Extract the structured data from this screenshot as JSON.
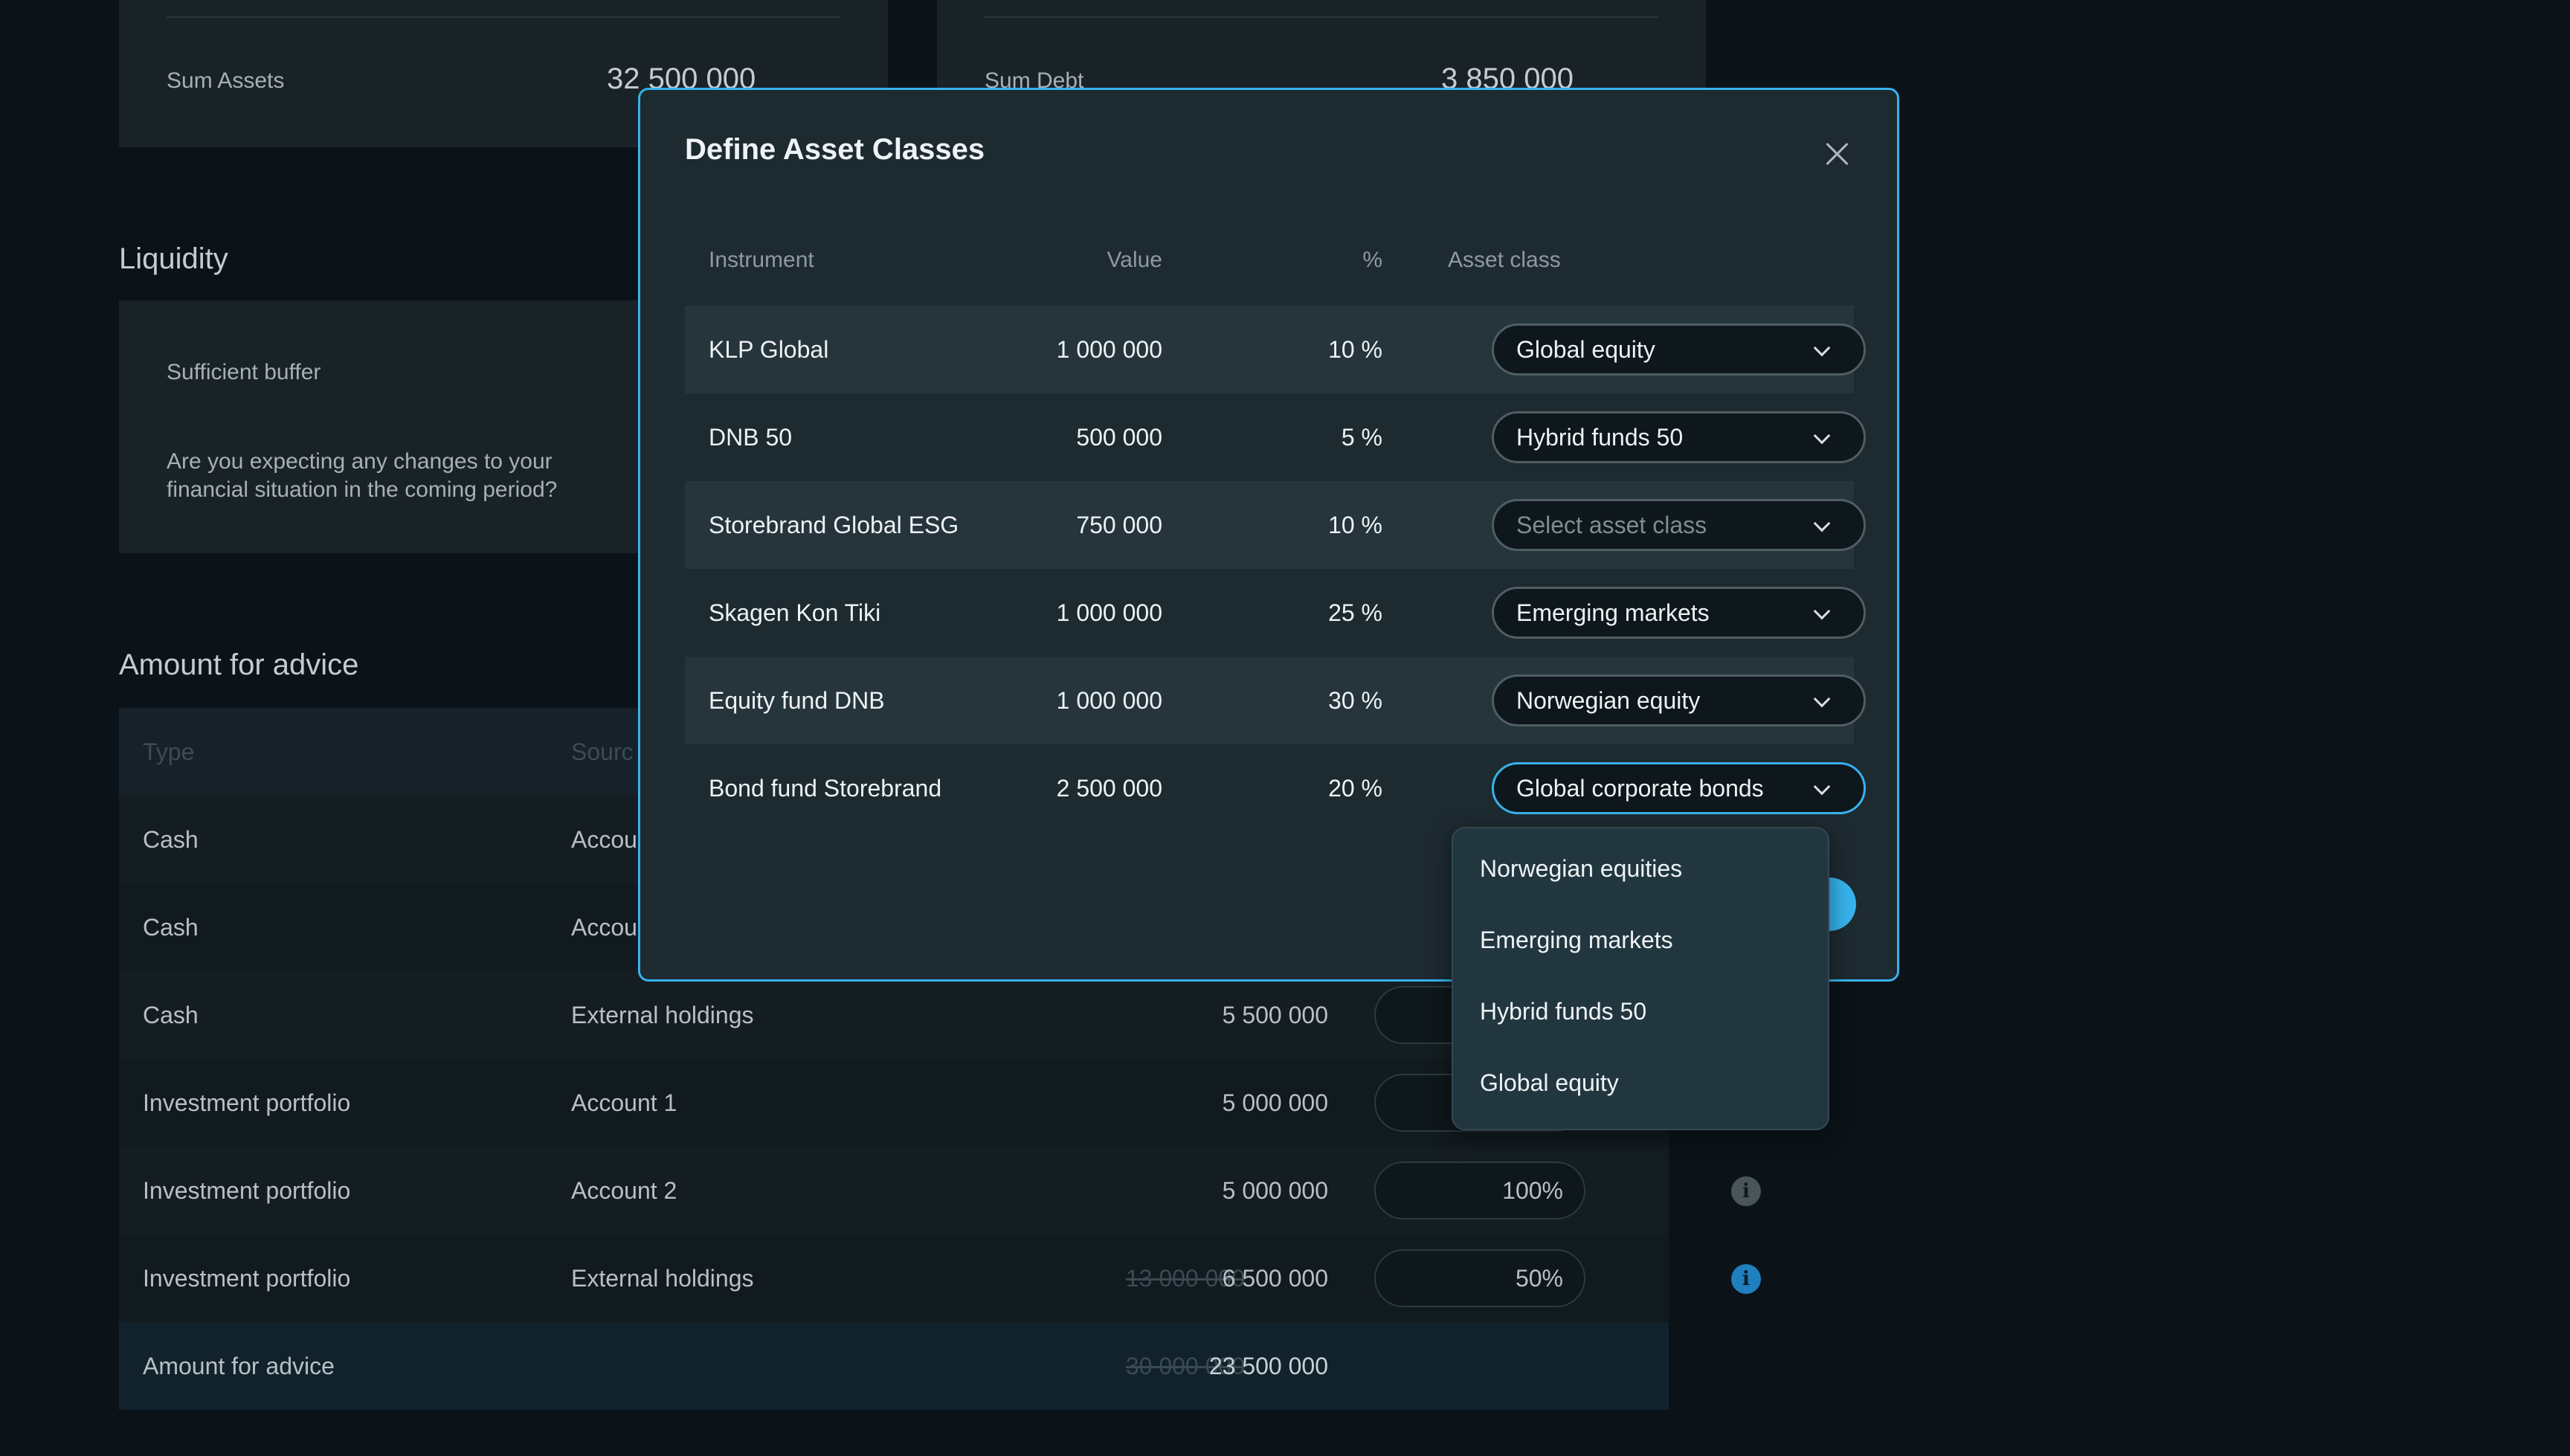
{
  "background": {
    "assets_card": {
      "label": "Sum Assets",
      "value": "32 500 000"
    },
    "debt_card": {
      "label": "Sum Debt",
      "value": "3 850 000"
    },
    "liquidity": {
      "title": "Liquidity",
      "buffer_label": "Sufficient buffer",
      "question_line1": "Are you expecting any changes to your",
      "question_line2": "financial situation in the coming period?"
    },
    "advice": {
      "title": "Amount for advice",
      "headers": {
        "type": "Type",
        "source": "Sourc"
      },
      "rows": [
        {
          "type": "Cash",
          "source": "Accou",
          "original": "",
          "value": "",
          "pct": ""
        },
        {
          "type": "Cash",
          "source": "Accou",
          "original": "",
          "value": "",
          "pct": ""
        },
        {
          "type": "Cash",
          "source": "External holdings",
          "original": "",
          "value": "5 500 000",
          "pct": ""
        },
        {
          "type": "Investment portfolio",
          "source": "Account 1",
          "original": "",
          "value": "5 000 000",
          "pct": ""
        },
        {
          "type": "Investment portfolio",
          "source": "Account 2",
          "original": "",
          "value": "5 000 000",
          "pct": "100%"
        },
        {
          "type": "Investment portfolio",
          "source": "External holdings",
          "original": "13 000 000",
          "value": "6 500 000",
          "pct": "50%"
        }
      ],
      "total": {
        "label": "Amount for advice",
        "original": "30 000 000",
        "value": "23 500 000"
      }
    }
  },
  "modal": {
    "title": "Define Asset Classes",
    "columns": {
      "instrument": "Instrument",
      "value": "Value",
      "percent": "%",
      "asset_class": "Asset class"
    },
    "rows": [
      {
        "instrument": "KLP Global",
        "value": "1 000 000",
        "percent": "10 %",
        "asset_class": "Global equity",
        "placeholder": false
      },
      {
        "instrument": "DNB 50",
        "value": "500 000",
        "percent": "5 %",
        "asset_class": "Hybrid funds 50",
        "placeholder": false
      },
      {
        "instrument": "Storebrand Global ESG",
        "value": "750 000",
        "percent": "10 %",
        "asset_class": "Select asset class",
        "placeholder": true
      },
      {
        "instrument": "Skagen Kon Tiki",
        "value": "1 000 000",
        "percent": "25 %",
        "asset_class": "Emerging markets",
        "placeholder": false
      },
      {
        "instrument": "Equity fund DNB",
        "value": "1 000 000",
        "percent": "30 %",
        "asset_class": "Norwegian equity",
        "placeholder": false
      },
      {
        "instrument": "Bond fund Storebrand",
        "value": "2 500 000",
        "percent": "20 %",
        "asset_class": "Global corporate bonds",
        "placeholder": false
      }
    ]
  },
  "dropdown": {
    "options": [
      "Norwegian equities",
      "Emerging markets",
      "Hybrid funds 50",
      "Global equity"
    ]
  },
  "icons": {
    "close": "close-icon",
    "chevron": "chevron-down-icon",
    "info": "info-icon"
  },
  "colors": {
    "accent": "#37b2ec",
    "background": "#0b1318",
    "modal": "#1d2a30"
  }
}
